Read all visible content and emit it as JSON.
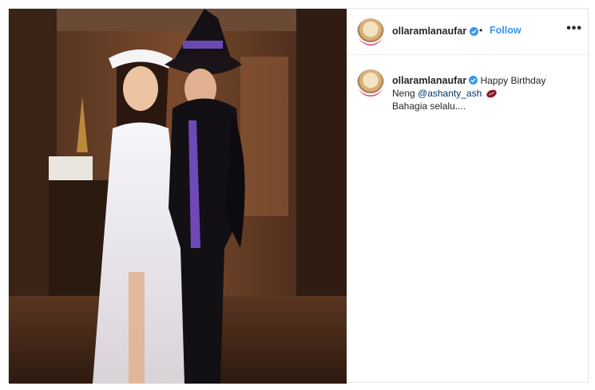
{
  "post": {
    "author": {
      "username": "ollaramlanaufar",
      "verified": true,
      "avatar_icon": "profile-avatar"
    },
    "header": {
      "separator": "•",
      "follow_label": "Follow",
      "more_label": "•••"
    },
    "caption": {
      "username": "ollaramlanaufar",
      "text_before_mention": "Happy Birthday Neng ",
      "mention": "@ashanty_ash",
      "emoji_icon": "rugby-ball-icon",
      "text_after": "Bahagia selalu...."
    },
    "colors": {
      "link_blue": "#3897f0",
      "mention_blue": "#003569",
      "verified_blue": "#3897f0",
      "text": "#262626"
    }
  }
}
